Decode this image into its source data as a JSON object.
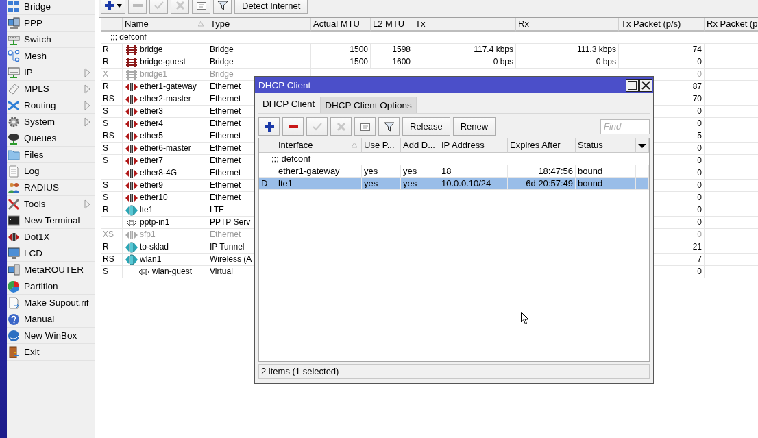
{
  "sidebar": {
    "items": [
      {
        "label": "Bridge",
        "submenu": false
      },
      {
        "label": "PPP",
        "submenu": false
      },
      {
        "label": "Switch",
        "submenu": false
      },
      {
        "label": "Mesh",
        "submenu": false
      },
      {
        "label": "IP",
        "submenu": true
      },
      {
        "label": "MPLS",
        "submenu": true
      },
      {
        "label": "Routing",
        "submenu": true
      },
      {
        "label": "System",
        "submenu": true
      },
      {
        "label": "Queues",
        "submenu": false
      },
      {
        "label": "Files",
        "submenu": false
      },
      {
        "label": "Log",
        "submenu": false
      },
      {
        "label": "RADIUS",
        "submenu": false
      },
      {
        "label": "Tools",
        "submenu": true
      },
      {
        "label": "New Terminal",
        "submenu": false
      },
      {
        "label": "Dot1X",
        "submenu": false
      },
      {
        "label": "LCD",
        "submenu": false
      },
      {
        "label": "MetaROUTER",
        "submenu": false
      },
      {
        "label": "Partition",
        "submenu": false
      },
      {
        "label": "Make Supout.rif",
        "submenu": false
      },
      {
        "label": "Manual",
        "submenu": false
      },
      {
        "label": "New WinBox",
        "submenu": false
      },
      {
        "label": "Exit",
        "submenu": false
      }
    ]
  },
  "interfaces": {
    "toolbar": {
      "detect_button": "Detect Internet"
    },
    "columns": [
      {
        "label": "Name",
        "sorted": true
      },
      {
        "label": "Type",
        "sorted": false
      },
      {
        "label": "Actual MTU",
        "sorted": false
      },
      {
        "label": "L2 MTU",
        "sorted": false
      },
      {
        "label": "Tx",
        "sorted": false
      },
      {
        "label": "Rx",
        "sorted": false
      },
      {
        "label": "Tx Packet (p/s)",
        "sorted": false
      },
      {
        "label": "Rx Packet (p",
        "sorted": false
      }
    ],
    "comment": ";;; defconf",
    "rows": [
      {
        "flags": "R",
        "kind": "bridge",
        "name": "bridge",
        "type": "Bridge",
        "actual_mtu": "1500",
        "l2_mtu": "1598",
        "tx": "117.4 kbps",
        "rx": "111.3 kbps",
        "tx_packet": "74",
        "disabled": false
      },
      {
        "flags": "R",
        "kind": "bridge",
        "name": "bridge-guest",
        "type": "Bridge",
        "actual_mtu": "1500",
        "l2_mtu": "1600",
        "tx": "0 bps",
        "rx": "0 bps",
        "tx_packet": "0",
        "disabled": false
      },
      {
        "flags": "X",
        "kind": "bridge",
        "name": "bridge1",
        "type": "Bridge",
        "tx_packet": "0",
        "disabled": true
      },
      {
        "flags": "R",
        "kind": "ethernet",
        "name": "ether1-gateway",
        "type": "Ethernet",
        "tx_packet": "87",
        "disabled": false
      },
      {
        "flags": "RS",
        "kind": "ethernet",
        "name": "ether2-master",
        "type": "Ethernet",
        "tx_packet": "70",
        "disabled": false
      },
      {
        "flags": "S",
        "kind": "ethernet",
        "name": "ether3",
        "type": "Ethernet",
        "tx_packet": "0",
        "disabled": false
      },
      {
        "flags": "S",
        "kind": "ethernet",
        "name": "ether4",
        "type": "Ethernet",
        "tx_packet": "0",
        "disabled": false
      },
      {
        "flags": "RS",
        "kind": "ethernet",
        "name": "ether5",
        "type": "Ethernet",
        "tx_packet": "5",
        "disabled": false
      },
      {
        "flags": "S",
        "kind": "ethernet",
        "name": "ether6-master",
        "type": "Ethernet",
        "tx_packet": "0",
        "disabled": false
      },
      {
        "flags": "S",
        "kind": "ethernet",
        "name": "ether7",
        "type": "Ethernet",
        "tx_packet": "0",
        "disabled": false
      },
      {
        "kind": "ethernet",
        "name": "ether8-4G",
        "type": "Ethernet",
        "tx_packet": "0",
        "disabled": false
      },
      {
        "flags": "S",
        "kind": "ethernet",
        "name": "ether9",
        "type": "Ethernet",
        "tx_packet": "0",
        "disabled": false
      },
      {
        "flags": "S",
        "kind": "ethernet",
        "name": "ether10",
        "type": "Ethernet",
        "tx_packet": "0",
        "disabled": false
      },
      {
        "flags": "R",
        "kind": "wireless",
        "name": "lte1",
        "type": "LTE",
        "tx_packet": "0",
        "disabled": false
      },
      {
        "kind": "virtual",
        "name": "pptp-in1",
        "type": "PPTP Serv",
        "tx_packet": "0",
        "disabled": false
      },
      {
        "flags": "XS",
        "kind": "ethernet",
        "name": "sfp1",
        "type": "Ethernet",
        "tx_packet": "0",
        "disabled": true
      },
      {
        "flags": "R",
        "kind": "wireless",
        "name": "to-sklad",
        "type": "IP Tunnel",
        "tx_packet": "21",
        "disabled": false
      },
      {
        "flags": "RS",
        "kind": "wireless",
        "name": "wlan1",
        "type": "Wireless (A",
        "tx_packet": "7",
        "disabled": false,
        "children": [
          {
            "flags": "S",
            "kind": "virtual",
            "name": "wlan-guest",
            "type": "Virtual",
            "tx_packet": "0",
            "disabled": false
          }
        ]
      }
    ]
  },
  "dhcp_window": {
    "title": "DHCP Client",
    "tabs": [
      {
        "label": "DHCP Client",
        "selected": true
      },
      {
        "label": "DHCP Client Options",
        "selected": false
      }
    ],
    "buttons": [
      "Release",
      "Renew"
    ],
    "find": {
      "placeholder": "Find"
    },
    "columns": [
      {
        "label": "Interface",
        "sorted": true
      },
      {
        "label": "Use P...",
        "sorted": false
      },
      {
        "label": "Add D...",
        "sorted": false
      },
      {
        "label": "IP Address",
        "sorted": false
      },
      {
        "label": "Expires After",
        "sorted": false
      },
      {
        "label": "Status",
        "sorted": false
      }
    ],
    "comment": ";;; defconf",
    "rows": [
      {
        "interface": "ether1-gateway",
        "use_peer_dns": "yes",
        "add_default_route": "yes",
        "ip_address": "18",
        "expires_after": "18:47:56",
        "status": "bound",
        "selected": false
      },
      {
        "flags": "D",
        "interface": "lte1",
        "use_peer_dns": "yes",
        "add_default_route": "yes",
        "ip_address": "10.0.0.10/24",
        "expires_after": "6d 20:57:49",
        "status": "bound",
        "selected": true
      }
    ],
    "status_bar": "2 items (1 selected)"
  }
}
